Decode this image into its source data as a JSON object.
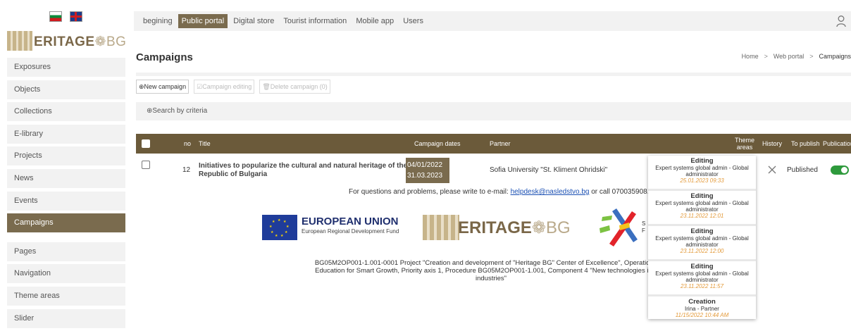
{
  "sidebar": {
    "logo_main": "ERITAGE",
    "logo_suffix": "BG",
    "items": [
      {
        "label": "Exposures"
      },
      {
        "label": "Objects"
      },
      {
        "label": "Collections"
      },
      {
        "label": "E-library"
      },
      {
        "label": "Projects"
      },
      {
        "label": "News"
      },
      {
        "label": "Events"
      },
      {
        "label": "Campaigns"
      },
      {
        "label": "Pages"
      },
      {
        "label": "Navigation"
      },
      {
        "label": "Theme areas"
      },
      {
        "label": "Slider"
      }
    ]
  },
  "topnav": {
    "tabs": [
      {
        "label": "begining"
      },
      {
        "label": "Public portal"
      },
      {
        "label": "Digital store"
      },
      {
        "label": "Tourist information"
      },
      {
        "label": "Mobile app"
      },
      {
        "label": "Users"
      }
    ]
  },
  "page": {
    "title": "Campaigns",
    "breadcrumb": {
      "home": "Home",
      "web_portal": "Web portal",
      "current": "Campaigns"
    }
  },
  "actions": {
    "new": "⊕New campaign",
    "edit": "☑Campaign editing",
    "delete": "🗑Delete campaign (0)"
  },
  "search": {
    "label": "⊕Search by criteria"
  },
  "table": {
    "headers": {
      "no": "no",
      "title": "Title",
      "dates": "Campaign dates",
      "partner": "Partner",
      "theme_line1": "Theme",
      "theme_line2": "areas",
      "history": "History",
      "to_publish": "To publish",
      "publication": "Publication"
    },
    "rows": [
      {
        "no": "12",
        "title": "Initiatives to popularize the cultural and natural heritage of the Republic of Bulgaria",
        "date_from": "04/01/2022",
        "date_to": "31.03.2023",
        "partner": "Sofia University \"St. Kliment Ohridski\"",
        "status": "Published",
        "publication_on": true
      }
    ]
  },
  "footer": {
    "contact_text": "For questions and problems, please write to e-mail: ",
    "email": "helpdesk@nasledstvo.bg",
    "contact_tail": " or call 070035908.",
    "eu_title": "EUROPEAN UNION",
    "eu_sub": "European Regional Development Fund",
    "op_s": "S",
    "op_f": "F",
    "project_line1": "BG05M2OP001-1.001-0001 Project \"Creation and development of \"Heritage BG\" Center of Excellence\", Operational Pr",
    "project_line2": "Education for Smart Growth, Priority axis 1, Procedure BG05M2OP001-1.001, Component 4 \"New technologies in crea",
    "project_line3": "industries\""
  },
  "history_popup": [
    {
      "action": "Editing",
      "user": "Expert systems global admin - Global administrator",
      "date": "25.01.2023 09:33"
    },
    {
      "action": "Editing",
      "user": "Expert systems global admin - Global administrator",
      "date": "23.11.2022 12:01"
    },
    {
      "action": "Editing",
      "user": "Expert systems global admin - Global administrator",
      "date": "23.11.2022 12:00"
    },
    {
      "action": "Editing",
      "user": "Expert systems global admin - Global administrator",
      "date": "23.11.2022 11:57"
    },
    {
      "action": "Creation",
      "user": "Irina - Partner",
      "date": "11/15/2022 10:44 AM"
    }
  ],
  "colors": {
    "brand": "#7a6b4e",
    "header": "#6b5a3a",
    "accent_date": "#e39a3a",
    "toggle": "#2e9a3c"
  }
}
